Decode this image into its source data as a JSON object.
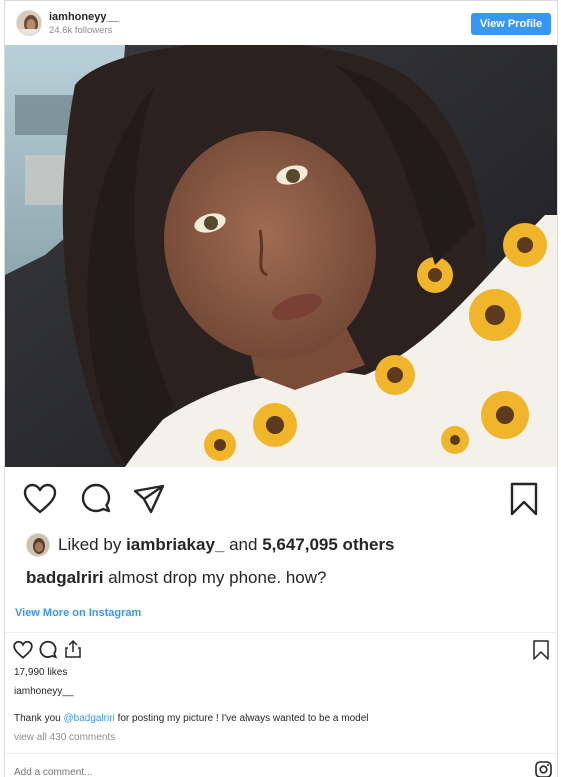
{
  "header": {
    "username": "iamhoneyy__",
    "followers": "24.6k followers",
    "view_profile_label": "View Profile"
  },
  "post": {
    "liked_by_prefix": "Liked by",
    "liked_by_user": "iambriakay_",
    "liked_by_and": "and",
    "liked_by_others": "5,647,095 others",
    "caption_user": "badgalriri",
    "caption_text": "almost drop my phone. how?",
    "view_more_label": "View More on Instagram"
  },
  "embed": {
    "likes": "17,990 likes",
    "owner": "iamhoneyy__",
    "comment_prefix": "Thank you",
    "comment_mention": "@badgalriri",
    "comment_suffix": "for posting my picture ! I've always wanted to be a model",
    "view_all_comments": "view all 430 comments",
    "add_comment_placeholder": "Add a comment..."
  },
  "icons": {
    "like": "heart-icon",
    "comment": "comment-bubble-icon",
    "share": "paper-plane-icon",
    "save": "bookmark-icon",
    "share_small": "upload-share-icon",
    "instagram": "instagram-logo-icon"
  },
  "colors": {
    "accent": "#3897f0",
    "text": "#262626",
    "muted": "#8e8e8e",
    "border": "#dbdbdb"
  }
}
